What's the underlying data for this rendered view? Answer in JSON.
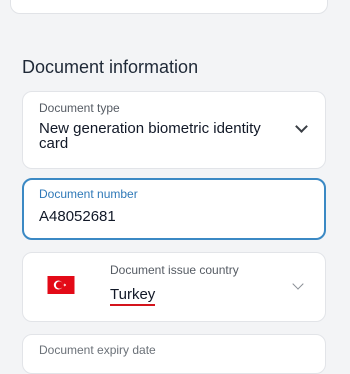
{
  "section": {
    "title": "Document information"
  },
  "document_type": {
    "label": "Document type",
    "value": "New generation biometric identity card"
  },
  "document_number": {
    "label": "Document number",
    "value": "A48052681"
  },
  "issue_country": {
    "label": "Document issue country",
    "value": "Turkey",
    "flag": "turkey-flag"
  },
  "expiry_date": {
    "label": "Document expiry date"
  },
  "colors": {
    "accent": "#3b89c4",
    "brand_underline": "#2d63d6",
    "flag_red": "#e30a17",
    "validation_underline": "#d4141c"
  }
}
